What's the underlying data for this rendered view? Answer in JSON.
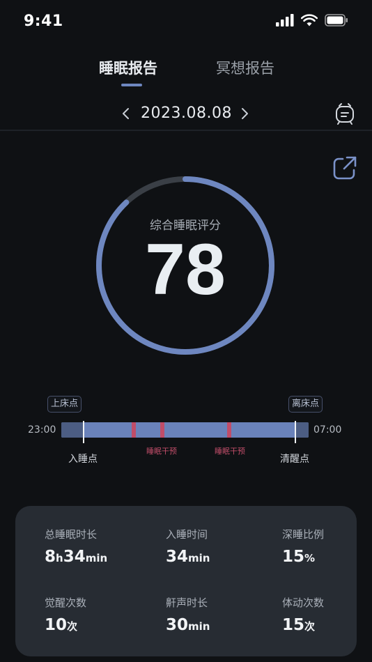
{
  "status_bar": {
    "time": "9:41"
  },
  "tabs": [
    {
      "label": "睡眠报告",
      "active": true
    },
    {
      "label": "冥想报告",
      "active": false
    }
  ],
  "date": {
    "value": "2023.08.08"
  },
  "score": {
    "label": "综合睡眠评分",
    "value": "78",
    "fraction": 0.88
  },
  "timeline": {
    "bed_tag": "上床点",
    "leave_tag": "离床点",
    "start_time": "23:00",
    "end_time": "07:00",
    "sleep_label": "入睡点",
    "wake_label": "清醒点",
    "intervention_label": "睡眠干预"
  },
  "stats": [
    {
      "label": "总睡眠时长",
      "parts": [
        {
          "num": "8",
          "unit": "h"
        },
        {
          "num": "34",
          "unit": "min"
        }
      ]
    },
    {
      "label": "入睡时间",
      "parts": [
        {
          "num": "34",
          "unit": "min"
        }
      ]
    },
    {
      "label": "深睡比例",
      "parts": [
        {
          "num": "15",
          "unit": "%"
        }
      ]
    },
    {
      "label": "觉醒次数",
      "parts": [
        {
          "num": "10",
          "unit": "次"
        }
      ]
    },
    {
      "label": "鼾声时长",
      "parts": [
        {
          "num": "30",
          "unit": "min"
        }
      ]
    },
    {
      "label": "体动次数",
      "parts": [
        {
          "num": "15",
          "unit": "次"
        }
      ]
    }
  ],
  "colors": {
    "background": "#0f1114",
    "accent": "#6e87c0",
    "ring_track": "#3a3f46",
    "intervention": "#c04d69",
    "card": "#272c33"
  },
  "icons": {
    "signal": "cellular-signal-icon",
    "wifi": "wifi-icon",
    "battery": "battery-icon",
    "prev": "chevron-left-icon",
    "next": "chevron-right-icon",
    "alarm": "alarm-clock-icon",
    "share": "share-icon"
  }
}
